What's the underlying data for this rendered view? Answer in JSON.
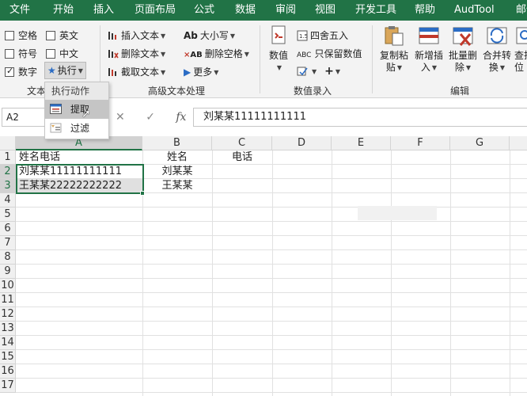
{
  "tabs": [
    "文件",
    "开始",
    "插入",
    "页面布局",
    "公式",
    "数据",
    "审阅",
    "视图",
    "开发工具",
    "帮助",
    "AudTool",
    "邮件"
  ],
  "ribbon": {
    "checkboxes": [
      {
        "label": "空格",
        "checked": false
      },
      {
        "label": "英文",
        "checked": false
      },
      {
        "label": "符号",
        "checked": false
      },
      {
        "label": "中文",
        "checked": false
      },
      {
        "label": "数字",
        "checked": true
      }
    ],
    "execute_label": "执行",
    "text_group_label": "文本",
    "adv_buttons": [
      "插入文本",
      "删除文本",
      "截取文本"
    ],
    "case_buttons": [
      "大小写",
      "删除空格",
      "更多"
    ],
    "adv_group_label": "高级文本处理",
    "number_button": "数值",
    "number_options": [
      "四舍五入",
      "只保留数值"
    ],
    "number_group_label": "数值录入",
    "edit_buttons": [
      {
        "line1": "复制粘",
        "line2": "贴"
      },
      {
        "line1": "新增插",
        "line2": "入"
      },
      {
        "line1": "批量删",
        "line2": "除"
      },
      {
        "line1": "合并转",
        "line2": "换"
      },
      {
        "line1": "查找",
        "line2": "位"
      }
    ],
    "edit_group_label": "编辑"
  },
  "dropdown": {
    "header": "执行动作",
    "items": [
      "提取",
      "过滤"
    ],
    "highlighted_index": 0
  },
  "formula_bar": {
    "name_box": "A2",
    "fx": "fx",
    "content": "刘某某11111111111"
  },
  "grid": {
    "columns": [
      "A",
      "B",
      "C",
      "D",
      "E",
      "F",
      "G"
    ],
    "rows": [
      "1",
      "2",
      "3",
      "4",
      "5",
      "6",
      "7",
      "8",
      "9",
      "10",
      "11",
      "12",
      "13",
      "14",
      "15",
      "16",
      "17"
    ],
    "cells": {
      "A1": "姓名电话",
      "B1": "姓名",
      "C1": "电话",
      "A2": "刘某某11111111111",
      "B2": "刘某某",
      "A3": "王某某22222222222",
      "B3": "王某某"
    },
    "active_cell": "A2",
    "selection": "A2:A3"
  },
  "colors": {
    "accent": "#217346",
    "selection_border": "#217346",
    "menu_highlight": "#c5c5c5"
  }
}
